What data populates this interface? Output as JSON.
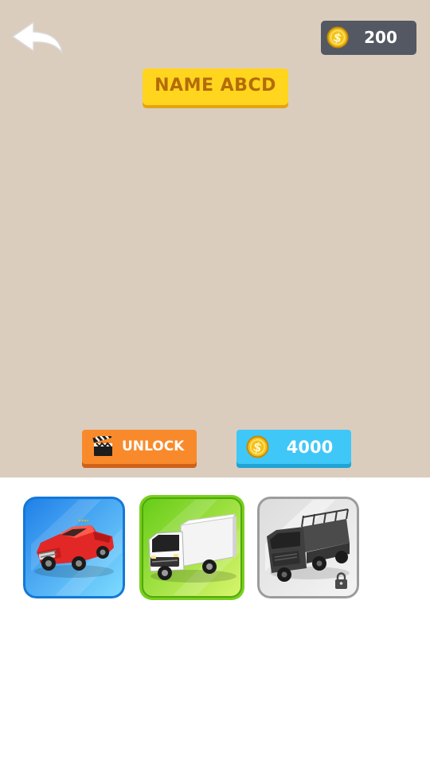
{
  "header": {
    "back_icon": "back-arrow-icon",
    "coins": "200",
    "coin_icon": "gold-coin-icon"
  },
  "vehicle": {
    "name": "NAME ABCD"
  },
  "actions": {
    "unlock_label": "UNLOCK",
    "unlock_icon": "clapperboard-icon",
    "price": "4000",
    "price_icon": "gold-coin-icon"
  },
  "vehicles": [
    {
      "kind": "red-pickup-truck",
      "state": "owned",
      "color": "#2b8ff2"
    },
    {
      "kind": "white-box-truck",
      "state": "selected",
      "color": "#7dd321"
    },
    {
      "kind": "dark-cargo-truck",
      "state": "locked",
      "color": "#a0a0a0",
      "lock_icon": "padlock-icon"
    }
  ],
  "colors": {
    "background_top": "#dbcdbd",
    "background_bottom": "#ffffff",
    "badge": "#ffd51e",
    "unlock_button": "#f98a2b",
    "price_button": "#3fc7f7",
    "coin_panel": "#535862"
  }
}
